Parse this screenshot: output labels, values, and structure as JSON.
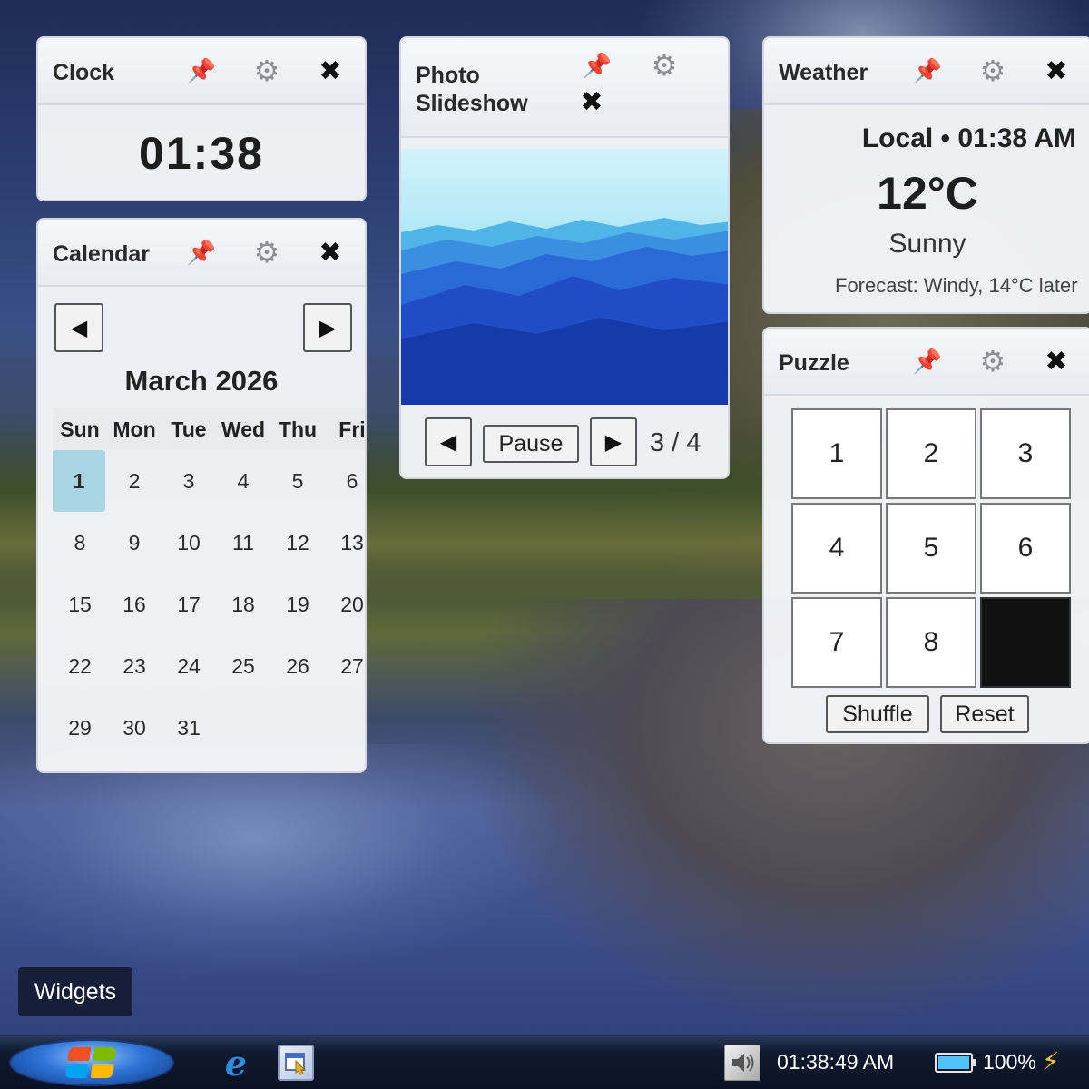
{
  "widgets": {
    "clock": {
      "title": "Clock",
      "time": "01:38"
    },
    "calendar": {
      "title": "Calendar",
      "prev": "◀",
      "next": "▶",
      "month": "March 2026",
      "weekdays": [
        "Sun",
        "Mon",
        "Tue",
        "Wed",
        "Thu",
        "Fri"
      ],
      "weeks": [
        [
          "1",
          "2",
          "3",
          "4",
          "5",
          "6"
        ],
        [
          "8",
          "9",
          "10",
          "11",
          "12",
          "13"
        ],
        [
          "15",
          "16",
          "17",
          "18",
          "19",
          "20"
        ],
        [
          "22",
          "23",
          "24",
          "25",
          "26",
          "27"
        ],
        [
          "29",
          "30",
          "31",
          "",
          "",
          ""
        ]
      ],
      "today": "1"
    },
    "slideshow": {
      "title_line1": "Photo",
      "title_line2": "Slideshow",
      "prev": "◀",
      "pause": "Pause",
      "next": "▶",
      "counter": "3 / 4",
      "current": 3,
      "total": 4
    },
    "weather": {
      "title": "Weather",
      "local": "Local • 01:38 AM",
      "temp": "12°C",
      "condition": "Sunny",
      "forecast": "Forecast: Windy, 14°C later"
    },
    "puzzle": {
      "title": "Puzzle",
      "tiles": [
        "1",
        "2",
        "3",
        "4",
        "5",
        "6",
        "7",
        "8",
        ""
      ],
      "shuffle": "Shuffle",
      "reset": "Reset"
    }
  },
  "icons": {
    "pin": "📌",
    "gear": "⚙",
    "close": "✖"
  },
  "sidebar_label": "Widgets",
  "taskbar": {
    "ie_glyph": "e",
    "time": "01:38:49 AM",
    "battery_percent": "100%",
    "battery_level": 1.0,
    "bolt": "⚡"
  },
  "colors": {
    "today_highlight": "#a9d4e2",
    "accent_pin": "#d32c2c",
    "battery_fill": "#4fc3ff",
    "bolt": "#f2c21b"
  }
}
